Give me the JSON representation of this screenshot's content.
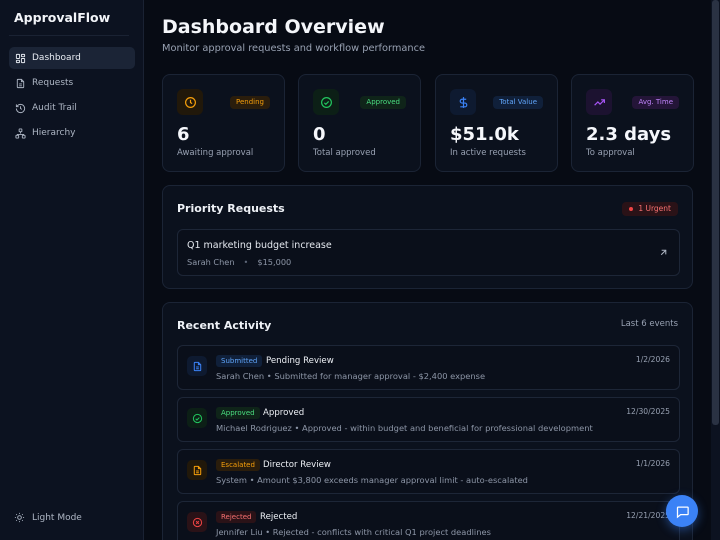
{
  "app": {
    "brand": "ApprovalFlow"
  },
  "sidebar": {
    "items": [
      {
        "label": "Dashboard",
        "icon": "dashboard-icon",
        "active": true
      },
      {
        "label": "Requests",
        "icon": "file-text-icon"
      },
      {
        "label": "Audit Trail",
        "icon": "history-icon"
      },
      {
        "label": "Hierarchy",
        "icon": "hierarchy-icon"
      }
    ],
    "footer": {
      "label": "Light Mode",
      "icon": "sun-icon"
    }
  },
  "header": {
    "title": "Dashboard Overview",
    "subtitle": "Monitor approval requests and workflow performance"
  },
  "stats": [
    {
      "badge": "Pending",
      "value": "6",
      "label": "Awaiting approval",
      "icon": "clock-icon",
      "color": "#f59e0b"
    },
    {
      "badge": "Approved",
      "value": "0",
      "label": "Total approved",
      "icon": "check-circle-icon",
      "color": "#22c55e"
    },
    {
      "badge": "Total Value",
      "value": "$51.0k",
      "label": "In active requests",
      "icon": "dollar-icon",
      "color": "#3b82f6"
    },
    {
      "badge": "Avg. Time",
      "value": "2.3 days",
      "label": "To approval",
      "icon": "trending-up-icon",
      "color": "#a855f7"
    }
  ],
  "priority": {
    "title": "Priority Requests",
    "badge": "1 Urgent",
    "item": {
      "title": "Q1 marketing budget increase",
      "requester": "Sarah Chen",
      "separator": "•",
      "amount": "$15,000"
    }
  },
  "activity": {
    "title": "Recent Activity",
    "count_label": "Last 6 events",
    "items": [
      {
        "status": "Submitted",
        "title": "Pending Review",
        "desc": "Sarah Chen • Submitted for manager approval - $2,400 expense",
        "date": "1/2/2026",
        "icon": "file-text-icon",
        "color": "#3b82f6"
      },
      {
        "status": "Approved",
        "title": "Approved",
        "desc": "Michael Rodriguez • Approved - within budget and beneficial for professional development",
        "date": "12/30/2025",
        "icon": "check-circle-icon",
        "color": "#22c55e"
      },
      {
        "status": "Escalated",
        "title": "Director Review",
        "desc": "System • Amount $3,800 exceeds manager approval limit - auto-escalated",
        "date": "1/1/2026",
        "icon": "file-text-icon",
        "color": "#f59e0b"
      },
      {
        "status": "Rejected",
        "title": "Rejected",
        "desc": "Jennifer Liu • Rejected - conflicts with critical Q1 project deadlines",
        "date": "12/21/2025",
        "icon": "x-circle-icon",
        "color": "#ef4444"
      }
    ]
  },
  "chat": {
    "icon": "chat-icon"
  }
}
